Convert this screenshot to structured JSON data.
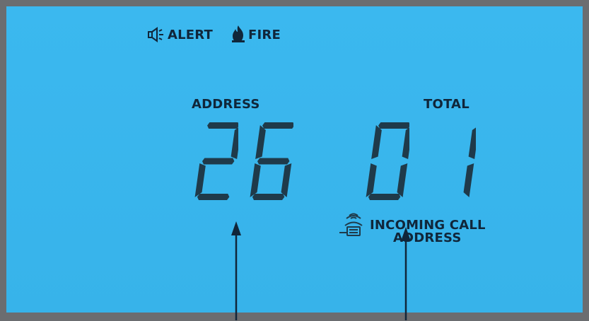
{
  "indicators": {
    "alert_label": "ALERT",
    "fire_label": "FIRE"
  },
  "address": {
    "label": "ADDRESS",
    "digits": [
      "2",
      "6"
    ]
  },
  "total": {
    "label": "TOTAL",
    "digits": [
      "0",
      "1"
    ]
  },
  "incoming_call": {
    "line1": "INCOMING CALL",
    "line2": "ADDRESS"
  },
  "colors": {
    "lcd_background": "#39b6ee",
    "segment": "#1f3a4a",
    "text": "#10263a",
    "frame": "#6b6d70"
  }
}
